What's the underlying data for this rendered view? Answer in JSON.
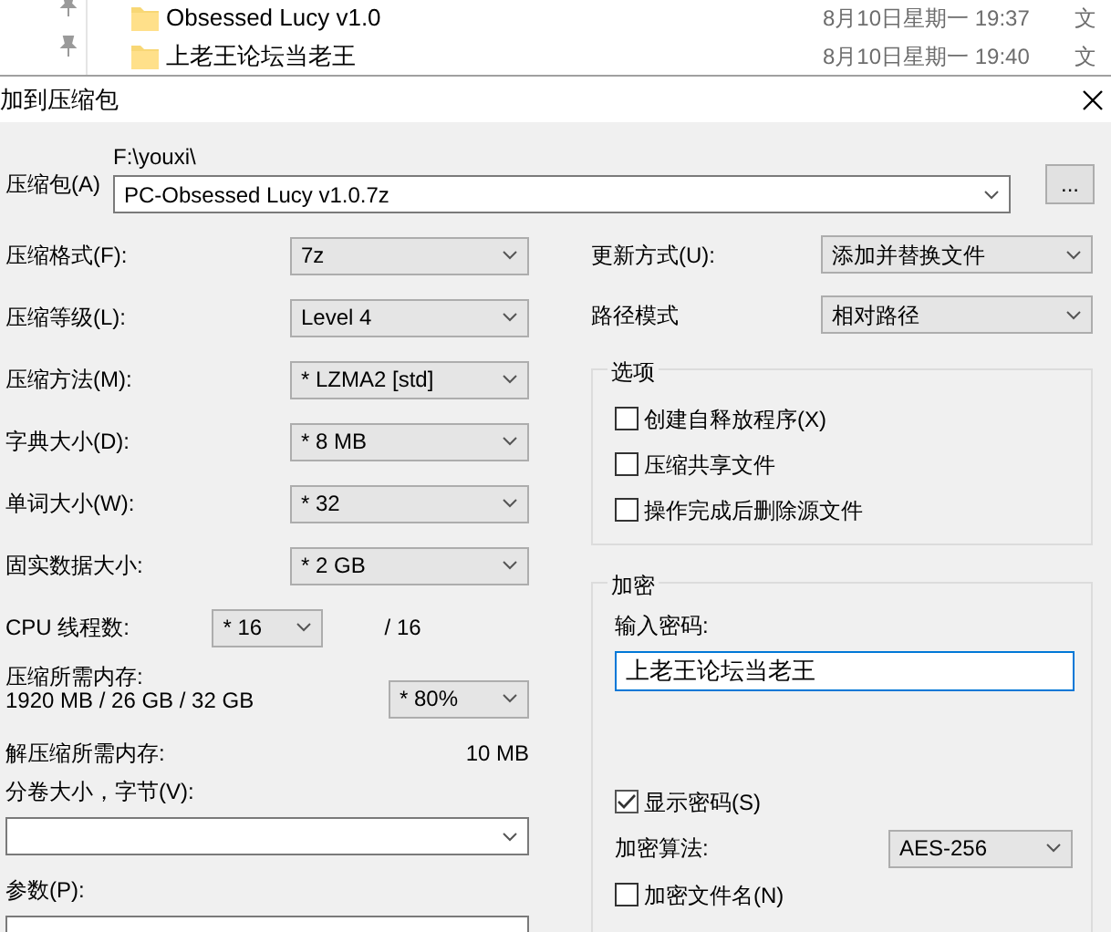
{
  "explorer": {
    "rows": [
      {
        "name": "Obsessed Lucy  v1.0",
        "date": "8月10日星期一 19:37",
        "column_3": "文"
      },
      {
        "name": "上老王论坛当老王",
        "date": "8月10日星期一 19:40",
        "column_3": "文"
      }
    ]
  },
  "dialog": {
    "title": "加到压缩包",
    "archive": {
      "label": "压缩包(A)",
      "path": "F:\\youxi\\",
      "value": "PC-Obsessed Lucy  v1.0.7z",
      "browse": "..."
    },
    "left": [
      {
        "kind": "select",
        "label": "压缩格式(F):",
        "value": "7z"
      },
      {
        "kind": "select",
        "label": "压缩等级(L):",
        "value": "Level 4"
      },
      {
        "kind": "select",
        "label": "压缩方法(M):",
        "value": "* LZMA2 [std]"
      },
      {
        "kind": "select",
        "label": "字典大小(D):",
        "value": "* 8 MB"
      },
      {
        "kind": "select",
        "label": "单词大小(W):",
        "value": "* 32"
      },
      {
        "kind": "select",
        "label": "固实数据大小:",
        "value": "* 2 GB"
      },
      {
        "kind": "cpu",
        "label": "CPU 线程数:",
        "value": "* 16",
        "total": "/ 16"
      },
      {
        "kind": "memory",
        "label": "压缩所需内存:",
        "detail": "1920 MB / 26 GB / 32 GB",
        "value": "* 80%"
      },
      {
        "kind": "info",
        "label": "解压缩所需内存:",
        "value": "10 MB"
      },
      {
        "kind": "combo",
        "label": "分卷大小，字节(V):"
      },
      {
        "kind": "field",
        "label": "参数(P):"
      }
    ],
    "right": {
      "update": {
        "label": "更新方式(U):",
        "value": "添加并替换文件"
      },
      "path_mode": {
        "label": "路径模式",
        "value": "相对路径"
      },
      "options": {
        "title": "选项",
        "items": [
          {
            "label": "创建自释放程序(X)",
            "checked": false
          },
          {
            "label": "压缩共享文件",
            "checked": false
          },
          {
            "label": "操作完成后删除源文件",
            "checked": false
          }
        ]
      },
      "encryption": {
        "title": "加密",
        "password_label": "输入密码:",
        "password": "上老王论坛当老王",
        "show_password": {
          "label": "显示密码(S)",
          "checked": true
        },
        "method_label": "加密算法:",
        "method": "AES-256",
        "encrypt_names": {
          "label": "加密文件名(N)",
          "checked": false
        }
      }
    }
  }
}
